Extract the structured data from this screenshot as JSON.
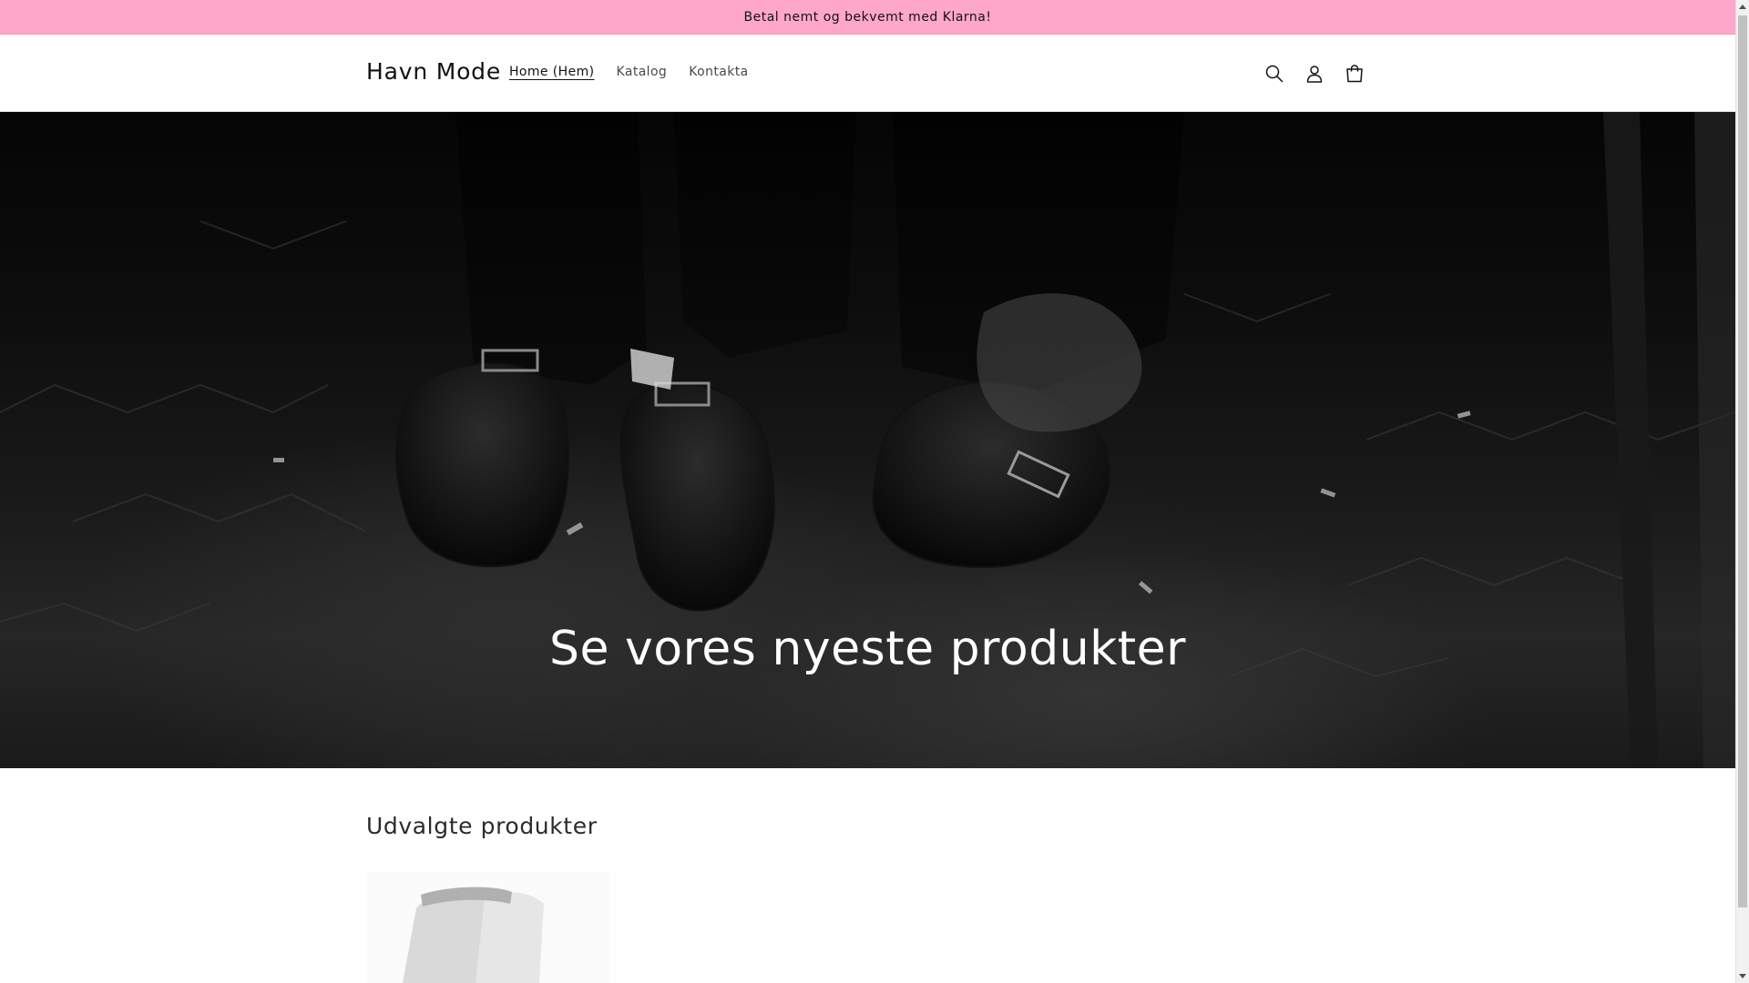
{
  "announcement": {
    "text": "Betal nemt og bekvemt med Klarna!"
  },
  "header": {
    "logo": "Havn Mode",
    "nav": [
      {
        "label": "Home (Hem)",
        "active": true
      },
      {
        "label": "Katalog",
        "active": false
      },
      {
        "label": "Kontakta",
        "active": false
      }
    ],
    "icons": [
      "search-icon",
      "account-icon",
      "cart-icon"
    ]
  },
  "hero": {
    "title": "Se vores nyeste produkter"
  },
  "featured": {
    "title": "Udvalgte produkter"
  },
  "colors": {
    "announcement_bg": "#ffa7cb",
    "text": "#121212",
    "hero_text": "#ffffff"
  }
}
